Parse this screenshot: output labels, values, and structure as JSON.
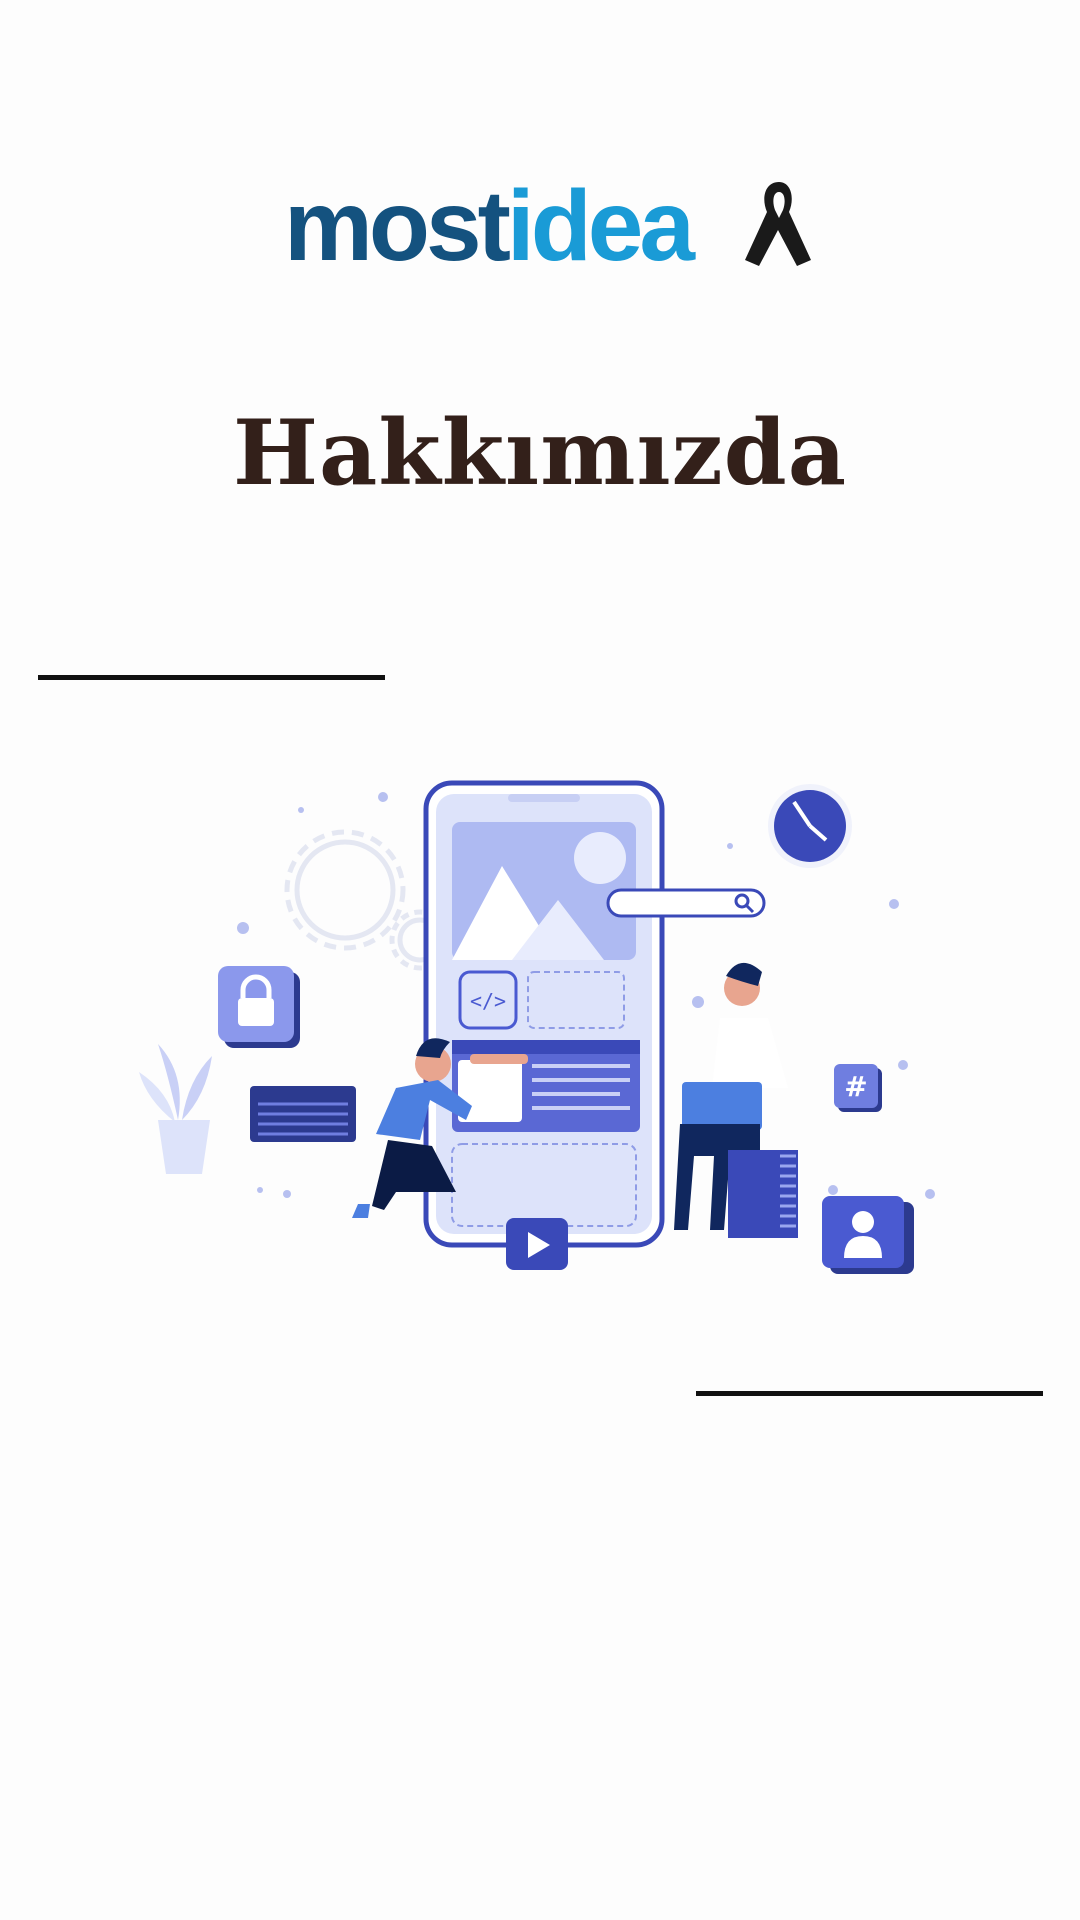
{
  "brand": {
    "logo_part1": "most",
    "logo_part2": "idea",
    "color_primary": "#14527f",
    "color_accent": "#1a9bd6"
  },
  "page": {
    "title": "Hakkımızda"
  },
  "illustration": {
    "icons": [
      "phone-mockup",
      "clock-icon",
      "lock-icon",
      "hashtag-icon",
      "user-icon",
      "play-icon",
      "search-icon",
      "code-icon",
      "gear-icon",
      "plant-icon"
    ],
    "palette": {
      "dark": "#2c3a8f",
      "mid": "#4a5ad1",
      "light": "#dde3fa",
      "accent": "#4c7fe0"
    }
  }
}
